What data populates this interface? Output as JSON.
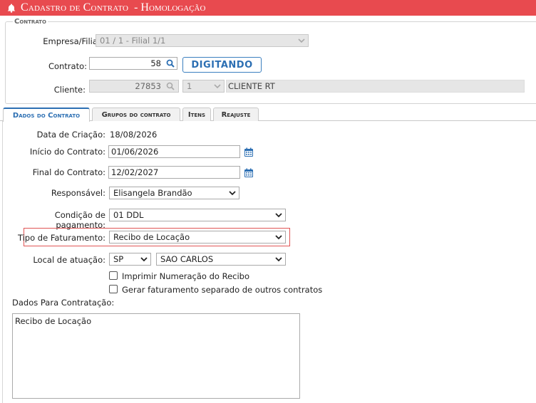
{
  "header": {
    "title": "Cadastro de Contrato",
    "subtitle": "- Homologação"
  },
  "contrato_section": {
    "legend": "Contrato",
    "empresa_label": "Empresa/Filial:",
    "empresa_value": "01 / 1 - Filial 1/1",
    "contrato_label": "Contrato:",
    "contrato_value": "58",
    "status_label": "DIGITANDO",
    "cliente_label": "Cliente:",
    "cliente_code": "27853",
    "cliente_loja": "1",
    "cliente_name": "CLIENTE RT"
  },
  "tabs": [
    {
      "label": "Dados do Contrato"
    },
    {
      "label": "Grupos do contrato"
    },
    {
      "label": "Itens"
    },
    {
      "label": "Reajuste"
    }
  ],
  "form": {
    "data_criacao_label": "Data de Criação:",
    "data_criacao_value": "18/08/2026",
    "inicio_label": "Início do Contrato:",
    "inicio_value": "01/06/2026",
    "final_label": "Final do Contrato:",
    "final_value": "12/02/2027",
    "responsavel_label": "Responsável:",
    "responsavel_value": "Elisangela Brandão",
    "condicao_label": "Condição de pagamento:",
    "condicao_value": "01 DDL",
    "tipo_fat_label": "Tipo de Faturamento:",
    "tipo_fat_value": "Recibo de Locação",
    "local_label": "Local de atuação:",
    "local_uf": "SP",
    "local_cidade": "SAO CARLOS",
    "chk_numeracao": "Imprimir Numeração do Recibo",
    "chk_separado": "Gerar faturamento separado de outros contratos",
    "dados_contratacao_label": "Dados Para Contratação:",
    "dados_contratacao_value": "Recibo de Locação"
  },
  "colors": {
    "header_bg": "#e84a4f",
    "accent": "#2c6fb3",
    "highlight": "#e05555"
  }
}
